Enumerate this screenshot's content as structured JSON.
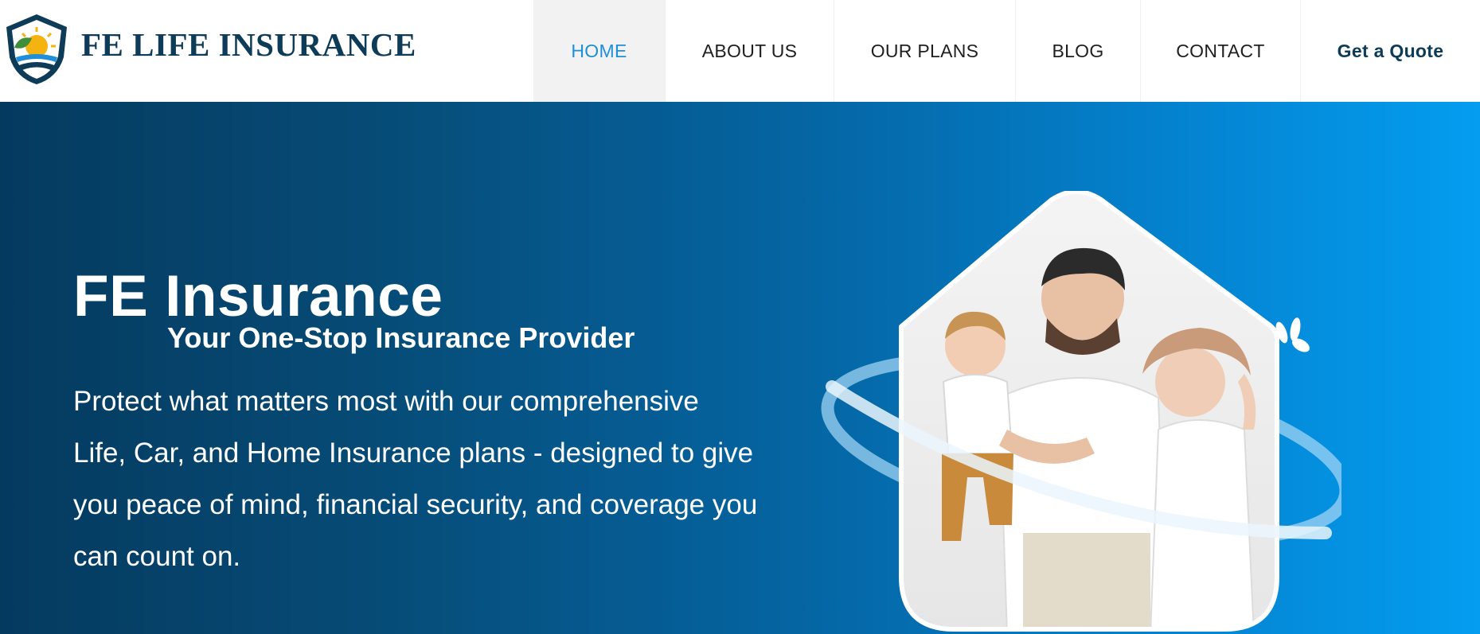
{
  "brand": {
    "name": "FE LIFE INSURANCE",
    "logo_icon": "shield-sun-leaf-icon",
    "colors": {
      "primary": "#0d3b58",
      "accent": "#1e8fd8",
      "sun": "#f5b312",
      "leaf": "#3f8f3a"
    }
  },
  "nav": {
    "items": [
      {
        "label": "HOME",
        "active": true
      },
      {
        "label": "ABOUT US",
        "active": false
      },
      {
        "label": "OUR PLANS",
        "active": false
      },
      {
        "label": "BLOG",
        "active": false
      },
      {
        "label": "CONTACT",
        "active": false
      }
    ],
    "cta_label": "Get a Quote"
  },
  "hero": {
    "title": "FE Insurance",
    "subtitle": "Your One-Stop Insurance Provider",
    "description": "Protect what matters most with our comprehensive Life, Car, and Home Insurance plans - designed to give you peace of mind, financial security, and coverage you can count on.",
    "image_icon": "family-house-photo",
    "gradient": [
      "#053a5f",
      "#064b76",
      "#0566a4",
      "#0483d0",
      "#049df0"
    ]
  }
}
